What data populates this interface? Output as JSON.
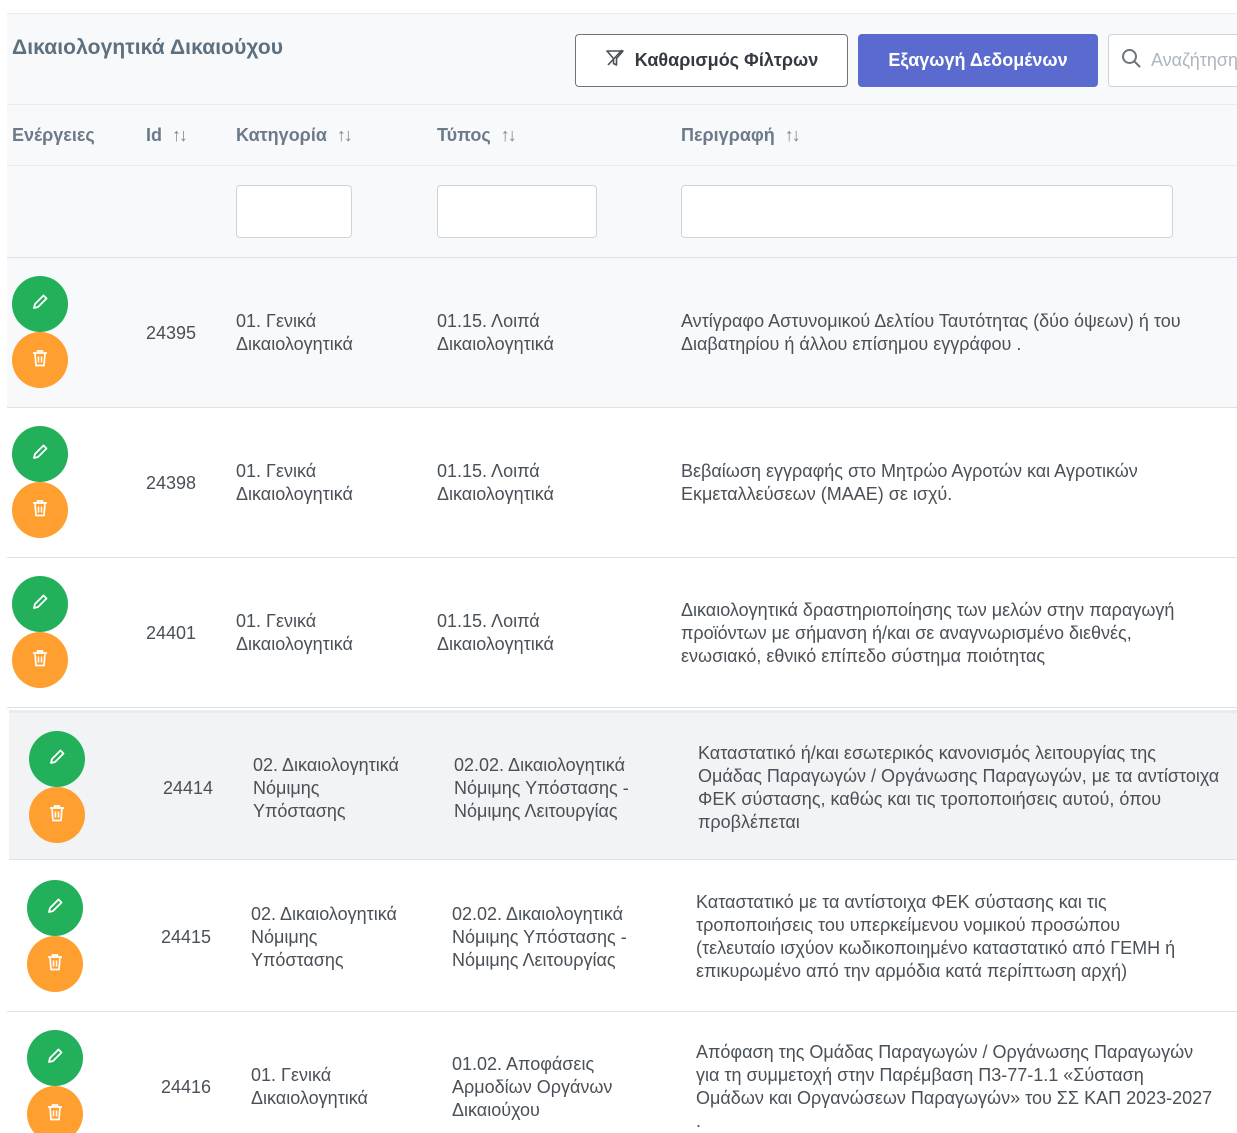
{
  "header": {
    "title": "Δικαιολογητικά Δικαιούχου",
    "clear_filters_label": "Καθαρισμός Φίλτρων",
    "export_label": "Εξαγωγή Δεδομένων",
    "search_placeholder": "Αναζήτηση"
  },
  "columns": {
    "actions": "Ενέργειες",
    "id": "Id",
    "category": "Κατηγορία",
    "type": "Τύπος",
    "description": "Περιγραφή",
    "sort_glyph": "↑↓"
  },
  "colors": {
    "edit": "#22b15a",
    "delete": "#ff9f2f",
    "primary": "#5a6acf"
  },
  "rows": [
    {
      "id": "24395",
      "category": [
        "01. Γενικά",
        "Δικαιολογητικά"
      ],
      "type": [
        "01.15. Λοιπά",
        "Δικαιολογητικά"
      ],
      "description": [
        "Αντίγραφο Αστυνομικού Δελτίου Ταυτότητας (δύο όψεων) ή του",
        "Διαβατηρίου ή άλλου επίσημου εγγράφου ."
      ]
    },
    {
      "id": "24398",
      "category": [
        "01. Γενικά",
        "Δικαιολογητικά"
      ],
      "type": [
        "01.15. Λοιπά",
        "Δικαιολογητικά"
      ],
      "description": [
        "Βεβαίωση εγγραφής στο Μητρώο Αγροτών και Αγροτικών",
        "Εκμεταλλεύσεων (ΜΑΑΕ) σε ισχύ."
      ]
    },
    {
      "id": "24401",
      "category": [
        "01. Γενικά",
        "Δικαιολογητικά"
      ],
      "type": [
        "01.15. Λοιπά",
        "Δικαιολογητικά"
      ],
      "description": [
        "Δικαιολογητικά δραστηριοποίησης των μελών στην παραγωγή",
        "προϊόντων με σήμανση ή/και σε αναγνωρισμένο διεθνές,",
        "ενωσιακό, εθνικό επίπεδο σύστημα ποιότητας"
      ]
    },
    {
      "id": "24414",
      "category": [
        "02. Δικαιολογητικά",
        "Νόμιμης",
        "Υπόστασης"
      ],
      "type": [
        "02.02. Δικαιολογητικά",
        "Νόμιμης Υπόστασης -",
        "Νόμιμης Λειτουργίας"
      ],
      "description": [
        "Καταστατικό ή/και εσωτερικός κανονισμός λειτουργίας της",
        "Ομάδας Παραγωγών / Οργάνωσης Παραγωγών, με τα αντίστοιχα",
        "ΦΕΚ σύστασης, καθώς και τις τροποποιήσεις αυτού, όπου",
        "προβλέπεται"
      ]
    },
    {
      "id": "24415",
      "category": [
        "02. Δικαιολογητικά",
        "Νόμιμης",
        "Υπόστασης"
      ],
      "type": [
        "02.02. Δικαιολογητικά",
        "Νόμιμης Υπόστασης -",
        "Νόμιμης Λειτουργίας"
      ],
      "description": [
        "Καταστατικό με τα αντίστοιχα ΦΕΚ σύστασης και τις",
        "τροποποιήσεις του υπερκείμενου νομικού προσώπου",
        "(τελευταίο ισχύον κωδικοποιημένο καταστατικό από ΓΕΜΗ ή",
        "επικυρωμένο από την αρμόδια κατά περίπτωση αρχή)"
      ]
    },
    {
      "id": "24416",
      "category": [
        "01. Γενικά",
        "Δικαιολογητικά"
      ],
      "type": [
        "01.02. Αποφάσεις",
        "Αρμοδίων Οργάνων",
        "Δικαιούχου"
      ],
      "description": [
        "Απόφαση της Ομάδας Παραγωγών / Οργάνωσης Παραγωγών",
        "για τη συμμετοχή στην Παρέμβαση Π3-77-1.1 «Σύσταση",
        "Ομάδων και Οργανώσεων Παραγωγών» του ΣΣ ΚΑΠ 2023-2027",
        "."
      ]
    }
  ]
}
